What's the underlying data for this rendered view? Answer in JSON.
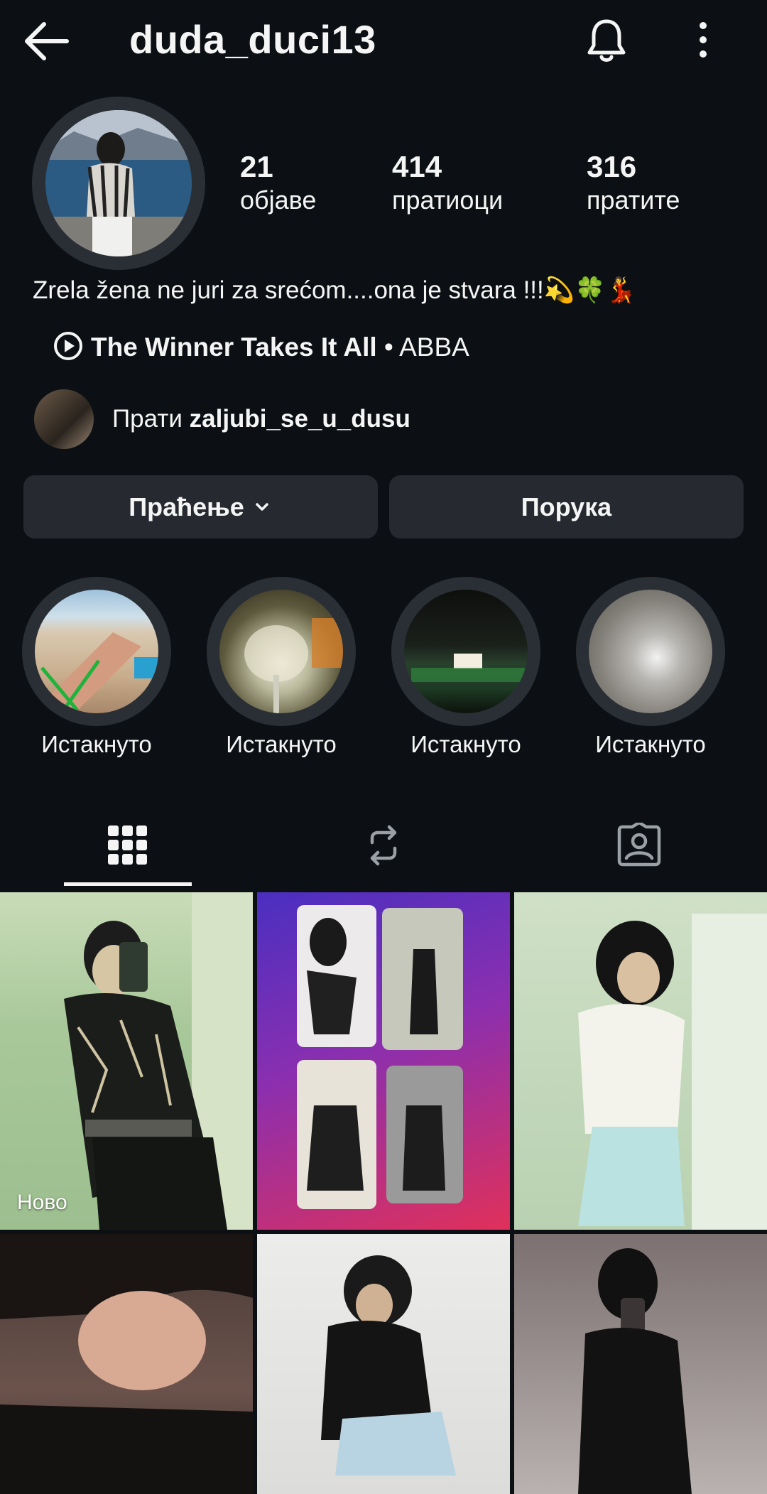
{
  "header": {
    "username": "duda_duci13",
    "back_icon": "arrow-left-icon",
    "bell_icon": "bell-icon",
    "more_icon": "more-vertical-icon"
  },
  "profile": {
    "stats": [
      {
        "count": "21",
        "label": "објаве"
      },
      {
        "count": "414",
        "label": "пратиоци"
      },
      {
        "count": "316",
        "label": "пратите"
      }
    ],
    "bio": "Zrela žena ne juri za srećom....ona je stvara !!!💫🍀💃",
    "music": {
      "title": "The Winner Takes It All",
      "separator": " • ",
      "artist": "ABBA"
    },
    "followed_by": {
      "prefix": "Прати ",
      "username": "zaljubi_se_u_dusu"
    }
  },
  "buttons": {
    "following": "Праћење",
    "message": "Порука"
  },
  "highlights": [
    {
      "label": "Истакнуто"
    },
    {
      "label": "Истакнуто"
    },
    {
      "label": "Истакнуто"
    },
    {
      "label": "Истакнуто"
    }
  ],
  "tabs": [
    {
      "icon": "grid-icon",
      "selected": true
    },
    {
      "icon": "repost-icon",
      "selected": false
    },
    {
      "icon": "tagged-person-icon",
      "selected": false
    }
  ],
  "grid": {
    "first_post_badge": "Ново"
  },
  "colors": {
    "background": "#0c1014",
    "button": "#262a30",
    "text": "#f5f5f5"
  }
}
